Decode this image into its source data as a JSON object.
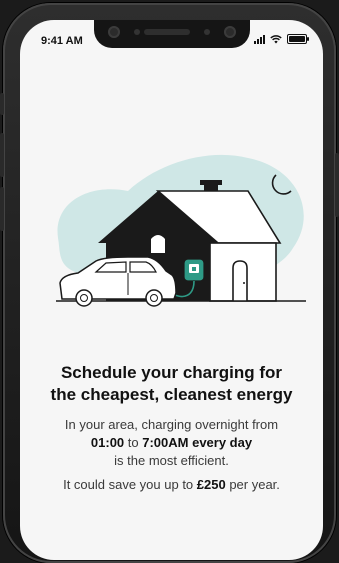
{
  "status_bar": {
    "time": "9:41 AM",
    "battery_level": 1.0
  },
  "illustration": {
    "icons": [
      "house-icon",
      "moon-icon",
      "car-icon",
      "charger-icon",
      "cloud-blob-icon"
    ],
    "colors": {
      "blob": "#cfe7e6",
      "house": "#1a1a1a",
      "charger": "#2e9a86"
    }
  },
  "content": {
    "headline_line1": "Schedule your charging for",
    "headline_line2": "the cheapest, cleanest energy",
    "body_line1": "In your area, charging overnight from",
    "body_start": "01:00",
    "body_to": " to ",
    "body_end": "7:00AM every day",
    "body_line3": "is the most efficient.",
    "savings_prefix": "It could save you up to ",
    "savings_amount": "£250",
    "savings_suffix": " per year."
  }
}
